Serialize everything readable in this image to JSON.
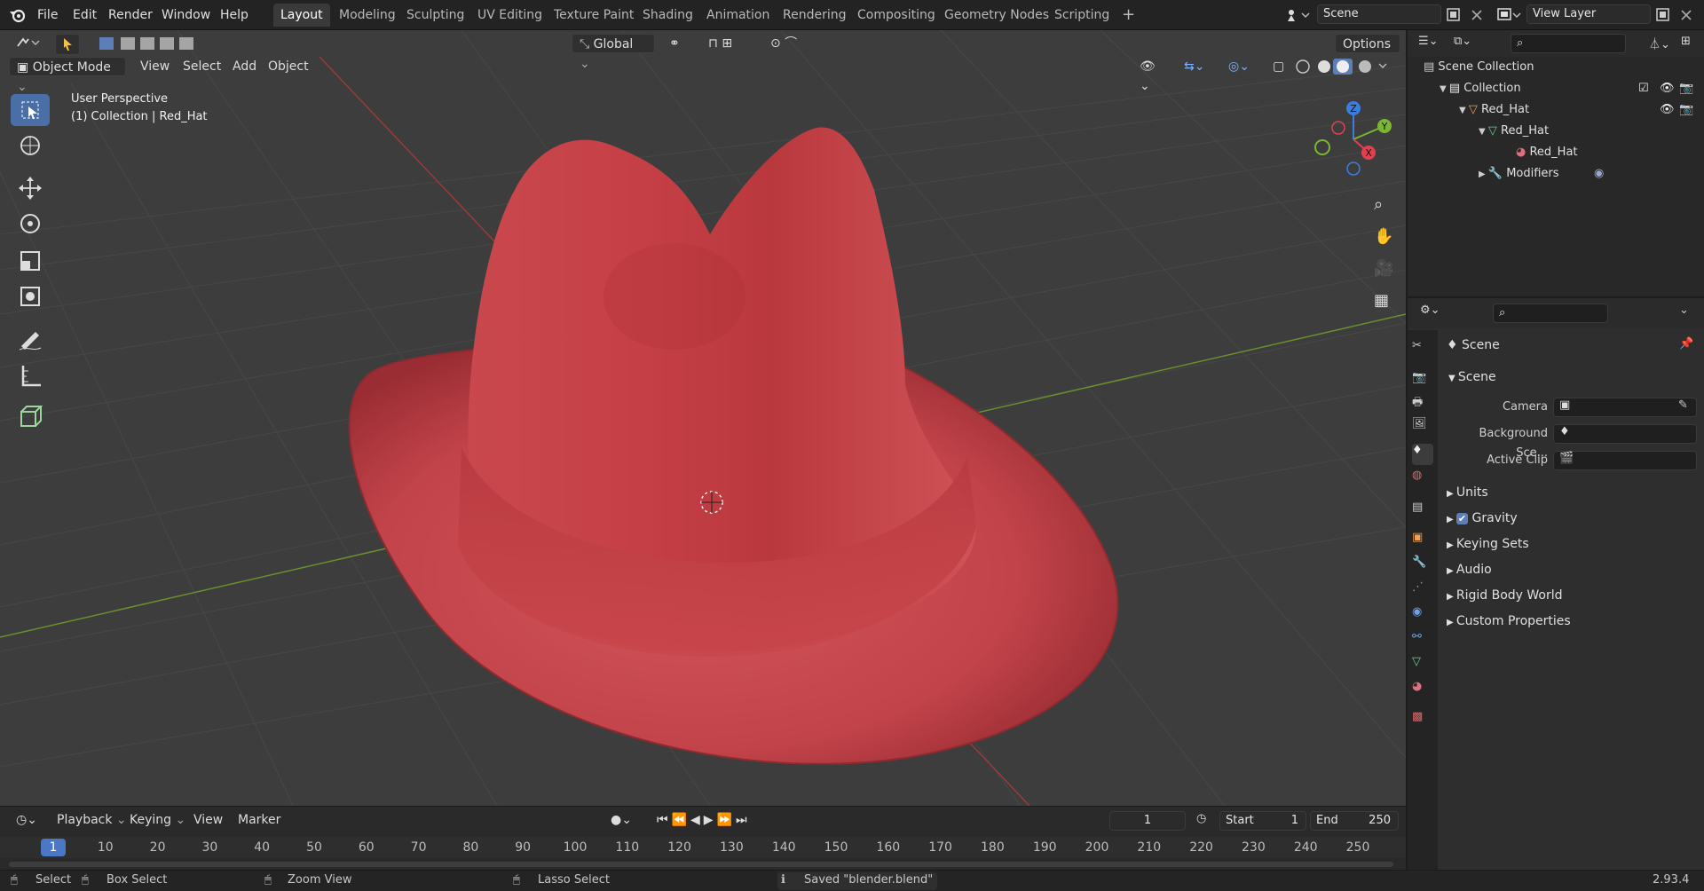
{
  "menu": [
    "File",
    "Edit",
    "Render",
    "Window",
    "Help"
  ],
  "workspaces": [
    {
      "label": "Layout",
      "active": true
    },
    {
      "label": "Modeling"
    },
    {
      "label": "Sculpting"
    },
    {
      "label": "UV Editing"
    },
    {
      "label": "Texture Paint"
    },
    {
      "label": "Shading"
    },
    {
      "label": "Animation"
    },
    {
      "label": "Rendering"
    },
    {
      "label": "Compositing"
    },
    {
      "label": "Geometry Nodes"
    },
    {
      "label": "Scripting"
    }
  ],
  "scene_field": "Scene",
  "view_layer_field": "View Layer",
  "viewport": {
    "mode": "Object Mode",
    "menus": [
      "View",
      "Select",
      "Add",
      "Object"
    ],
    "transform_orientation": "Global",
    "options_label": "Options",
    "overlay_line1": "User Perspective",
    "overlay_line2": "(1) Collection | Red_Hat",
    "gizmo_axes": {
      "x": "X",
      "y": "Y",
      "z": "Z"
    },
    "colors": {
      "hat": "#c9454a",
      "grid_x": "#9b3a3a",
      "grid_y": "#6a8f2e"
    }
  },
  "outliner": {
    "rows": [
      {
        "label": "Scene Collection"
      },
      {
        "label": "Collection"
      },
      {
        "label": "Red_Hat"
      },
      {
        "label": "Red_Hat"
      },
      {
        "label": "Red_Hat"
      },
      {
        "label": "Modifiers"
      }
    ]
  },
  "properties": {
    "header": "Scene",
    "section": "Scene",
    "fields": [
      {
        "label": "Camera"
      },
      {
        "label": "Background Sce..."
      },
      {
        "label": "Active Clip"
      }
    ],
    "subsections": [
      "Units",
      "Gravity",
      "Keying Sets",
      "Audio",
      "Rigid Body World",
      "Custom Properties"
    ],
    "gravity_checked": true
  },
  "timeline": {
    "menus": [
      "Playback",
      "Keying",
      "View",
      "Marker"
    ],
    "current_frame": "1",
    "start_label": "Start",
    "start_value": "1",
    "end_label": "End",
    "end_value": "250",
    "ticks": [
      "1",
      "10",
      "20",
      "30",
      "40",
      "50",
      "60",
      "70",
      "80",
      "90",
      "100",
      "110",
      "120",
      "130",
      "140",
      "150",
      "160",
      "170",
      "180",
      "190",
      "200",
      "210",
      "220",
      "230",
      "240",
      "250"
    ]
  },
  "status": {
    "select": "Select",
    "box_select": "Box Select",
    "zoom_view": "Zoom View",
    "lasso_select": "Lasso Select",
    "message": "Saved \"blender.blend\"",
    "version": "2.93.4"
  }
}
